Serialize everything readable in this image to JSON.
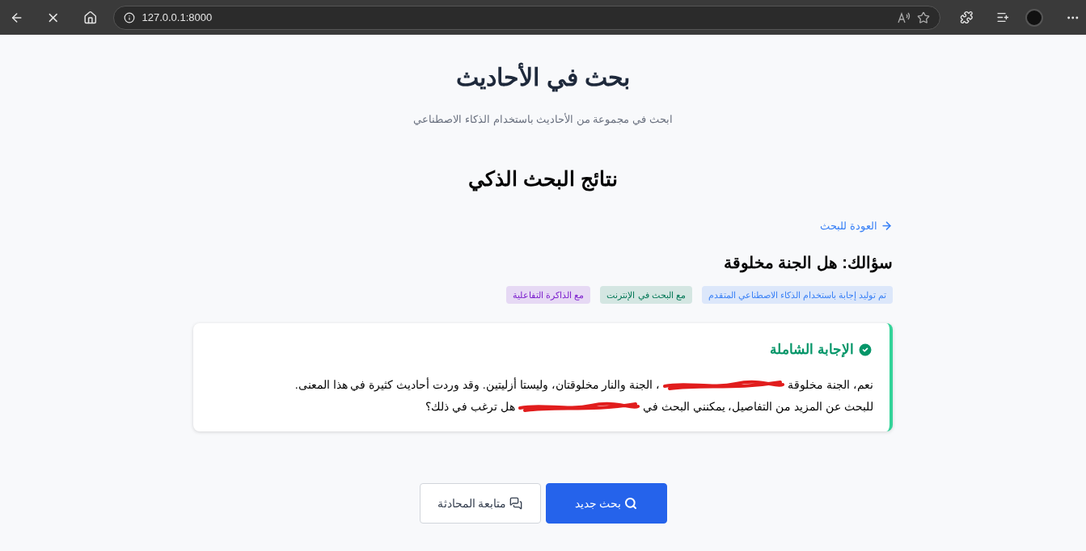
{
  "browser": {
    "url": "127.0.0.1:8000"
  },
  "header": {
    "title": "بحث في الأحاديث",
    "subtitle": "ابحث في مجموعة من الأحاديث باستخدام الذكاء الاصطناعي"
  },
  "results": {
    "heading": "نتائج البحث الذكي",
    "back_link": "العودة للبحث",
    "question": "سؤالك: هل الجنة مخلوقة",
    "badges": [
      {
        "label": "تم توليد إجابة باستخدام الذكاء الاصطناعي المتقدم",
        "color": "#3b82f6"
      },
      {
        "label": "مع البحث في الإنترنت",
        "color": "#047857"
      },
      {
        "label": "مع الذاكرة التفاعلية",
        "color": "#7e22ce"
      }
    ],
    "answer": {
      "title": "الإجابة الشاملة",
      "lines": [
        {
          "segments": [
            {
              "kind": "text",
              "text": "نعم، الجنة مخلوقة"
            },
            {
              "kind": "redaction"
            },
            {
              "kind": "text",
              "text": "، الجنة والنار مخلوقتان، وليستا أزليتين. وقد وردت أحاديث كثيرة في هذا المعنى."
            }
          ]
        },
        {
          "segments": [
            {
              "kind": "text",
              "text": "للبحث عن المزيد من التفاصيل، يمكنني البحث في"
            },
            {
              "kind": "redaction"
            },
            {
              "kind": "text",
              "text": "هل ترغب في ذلك؟"
            }
          ]
        }
      ]
    }
  },
  "buttons": [
    {
      "label": "بحث جديد",
      "kind": "primary"
    },
    {
      "label": "متابعة المحادثة",
      "kind": "secondary"
    }
  ]
}
